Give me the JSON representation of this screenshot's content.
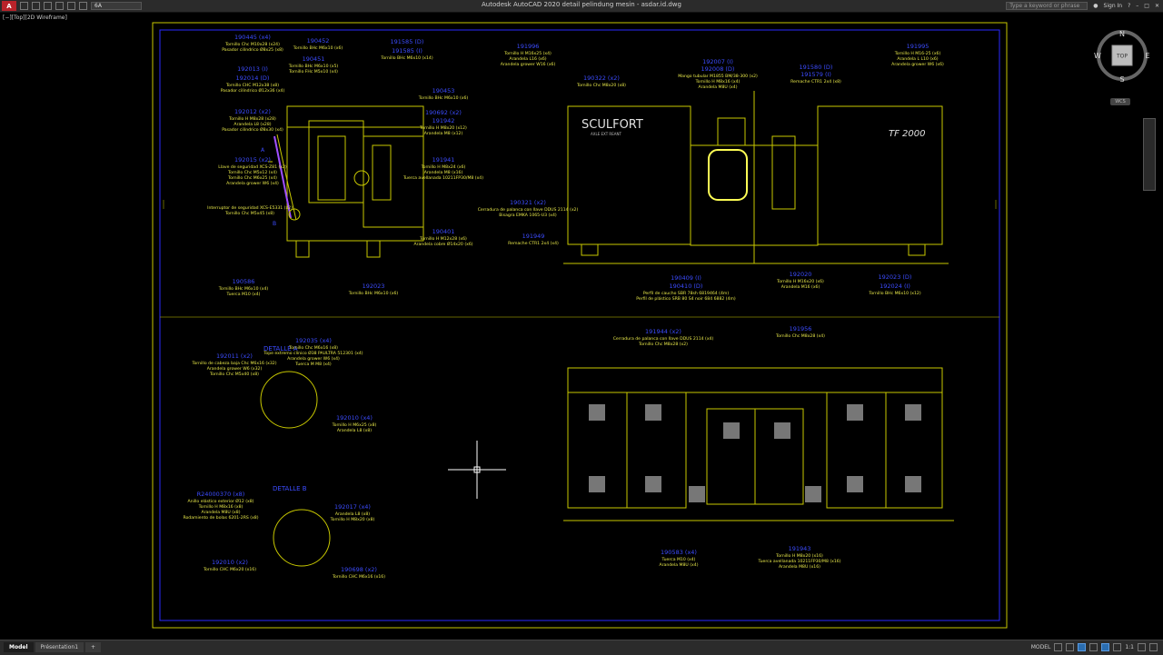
{
  "window": {
    "title": "Autodesk AutoCAD 2020   detail pelindung mesin - asdar.id.dwg",
    "layer_name": "6A",
    "search_placeholder": "Type a keyword or phrase",
    "sign_in": "Sign In",
    "viewport_label": "[−][Top][2D Wireframe]"
  },
  "viewcube": {
    "north": "N",
    "south": "S",
    "east": "E",
    "west": "W",
    "face": "TOP",
    "wcs": "WCS"
  },
  "status": {
    "model_tab": "Model",
    "layout_tab": "Présentation1",
    "add": "+",
    "model_space": "MODEL",
    "scale": "1:1"
  },
  "colors": {
    "frame": "#2a2aff",
    "sheet": "#c8c800",
    "label_blue": "#3c4cff",
    "label_yellow": "#e8e84a",
    "green": "#4caf50"
  },
  "drawing": {
    "brand": "SCULFORT",
    "brand_sub": "AXLE EXT REANT",
    "model": "TF 2000",
    "detail_a": "DETALLE A",
    "detail_b": "DETALLE B",
    "marker_a": "A",
    "marker_b": "B",
    "left_labels": [
      {
        "code": "190445 (x4)",
        "lines": [
          "Tornillo Chc M10x28 (x24)",
          "Pasador cilíndrico Ø8x25 (x8)"
        ]
      },
      {
        "code": "192013 (I)",
        "lines": []
      },
      {
        "code": "192014 (D)",
        "lines": [
          "Tornillo CHC M12x38 (x8)",
          "Pasador cilíndrico Ø12x36 (x4)"
        ]
      },
      {
        "code": "192012 (x2)",
        "lines": [
          "Tornillo H M8x28 (x28)",
          "Arandela L8 (x28)",
          "Pasador cilíndrico Ø8x30 (x4)"
        ]
      },
      {
        "code": "192015 (x2)",
        "lines": [
          "Llave de seguridad XCS-Z81 (x2)",
          "Tornillo Chc M5x12 (x4)",
          "Tornillo Chc M6x25 (x4)",
          "Arandela grower W6 (x4)"
        ]
      },
      {
        "code": "",
        "lines": [
          "Interruptor de seguridad XCS-E5331 (x2)",
          "Tornillo Chc M5x45 (x8)"
        ]
      },
      {
        "code": "190586",
        "lines": [
          "Tornillo BHc M6x10 (x4)",
          "Tuerca M10 (x4)"
        ]
      }
    ],
    "mid_top_labels": [
      {
        "code": "190452",
        "lines": [
          "Tornillo BHc M6x10 (x6)"
        ]
      },
      {
        "code": "190451",
        "lines": [
          "Tornillo BHc M6x10 (x5)",
          "Tornillo FHc M5x10 (x4)"
        ]
      },
      {
        "code": "191585 (D)",
        "lines": []
      },
      {
        "code": "191585 (I)",
        "lines": [
          "Tornillo BHc M6x10 (x14)"
        ]
      },
      {
        "code": "190453",
        "lines": [
          "Tornillo BHc M6x10 (x6)"
        ]
      },
      {
        "code": "190692 (x2)",
        "lines": []
      },
      {
        "code": "191942",
        "lines": [
          "Tornillo H M8x20 (x12)",
          "Arandela M8 (x12)"
        ]
      },
      {
        "code": "191941",
        "lines": [
          "Tornillo H M8x24 (x6)",
          "Arandela M8 (x16)",
          "Tuerca avellanada 10211FP30/M8 (x4)"
        ]
      },
      {
        "code": "190401",
        "lines": [
          "Tornillo H M12x28 (x6)",
          "Arandela cobre Ø14x20 (x6)"
        ]
      },
      {
        "code": "192023",
        "lines": [
          "Tornillo BHc M6x10 (x6)"
        ]
      }
    ],
    "right_top_labels": [
      {
        "code": "191996",
        "lines": [
          "Tornillo H M16x25 (x4)",
          "Arandela L16 (x6)",
          "Arandela grower W16 (x6)"
        ]
      },
      {
        "code": "190322 (x2)",
        "lines": [
          "Tornillo Chc M8x20 (x8)"
        ]
      },
      {
        "code": "192007 (I)",
        "lines": []
      },
      {
        "code": "192008 (D)",
        "lines": [
          "Mango tubular M1855 BM/38-300 (x2)",
          "Tornillo H M8x16 (x4)",
          "Arandela M8U (x4)"
        ]
      },
      {
        "code": "191580 (D)",
        "lines": []
      },
      {
        "code": "191579 (I)",
        "lines": [
          "Remache CTR1 2x4 (x8)"
        ]
      },
      {
        "code": "191995",
        "lines": [
          "Tornillo H M16-25 (x6)",
          "Arandela L L10 (x6)",
          "Arandela grower W6 (x6)"
        ]
      },
      {
        "code": "190321 (x2)",
        "lines": [
          "Cerradura de palanca con llave DDUS 2114 (x2)",
          "Bisagra EMKA 1065-U3 (x4)"
        ]
      },
      {
        "code": "191949",
        "lines": [
          "Remache CTR1 2x4 (x4)"
        ]
      },
      {
        "code": "190409 (I)",
        "lines": []
      },
      {
        "code": "190410 (D)",
        "lines": [
          "Perfil de caucho SBR 78sh 6819464 (4m)",
          "Perfil de plástico SRB 80 S4 noir 684 6882 (4m)"
        ]
      },
      {
        "code": "192020",
        "lines": [
          "Tornillo H M16x20 (x6)",
          "Arandela M16 (x6)"
        ]
      },
      {
        "code": "192023 (D)",
        "lines": []
      },
      {
        "code": "192024 (I)",
        "lines": [
          "Tornillo BHc M6x10 (x12)"
        ]
      }
    ],
    "bottom_right_labels": [
      {
        "code": "191944 (x2)",
        "lines": [
          "Cerradura de palanca con llave DDUS 2114 (x4)",
          "Tornillo Chc M8x28 (x2)"
        ]
      },
      {
        "code": "191956",
        "lines": [
          "Tornillo Chc M8x28 (x4)"
        ]
      },
      {
        "code": "190583 (x4)",
        "lines": [
          "Tuerca M10 (x4)",
          "Arandela M8U (x4)"
        ]
      },
      {
        "code": "191943",
        "lines": [
          "Tornillo H M8x20 (x16)",
          "Tuerca avellanada 10211FP30/M8 (x16)",
          "Arandela M8U (x16)"
        ]
      }
    ],
    "detail_a_labels": [
      {
        "code": "192011 (x2)",
        "lines": [
          "Tornillo de cabeza baja Chc M6x16 (x32)",
          "Arandela grower W6 (x32)",
          "Tornillo Chc M5x40 (x8)"
        ]
      },
      {
        "code": "192035 (x4)",
        "lines": [
          "Tornillo Chc M6x16 (x8)",
          "Tope extremo clínico Ø38 PAULTRA 512301 (x4)",
          "Arandela grower W6 (x4)",
          "Tuerca M M8 (x4)"
        ]
      },
      {
        "code": "192010 (x4)",
        "lines": [
          "Tornillo H M6x25 (x8)",
          "Arandela L8 (x8)"
        ]
      }
    ],
    "detail_b_labels": [
      {
        "code": "R24000370 (x8)",
        "lines": [
          "Anillo elástico exterior Ø12 (x8)",
          "Tornillo H M8x16 (x8)",
          "Arandela M8U (x8)",
          "Rodamiento de bolas 6201-2RS (x8)"
        ]
      },
      {
        "code": "192017 (x4)",
        "lines": [
          "Arandela L8 (x8)",
          "Tornillo H M8x20 (x8)"
        ]
      },
      {
        "code": "192010 (x2)",
        "lines": [
          "Tornillo CHC M6x20 (x16)"
        ]
      },
      {
        "code": "190698 (x2)",
        "lines": [
          "Tornillo CHC M6x16 (x16)"
        ]
      }
    ]
  }
}
